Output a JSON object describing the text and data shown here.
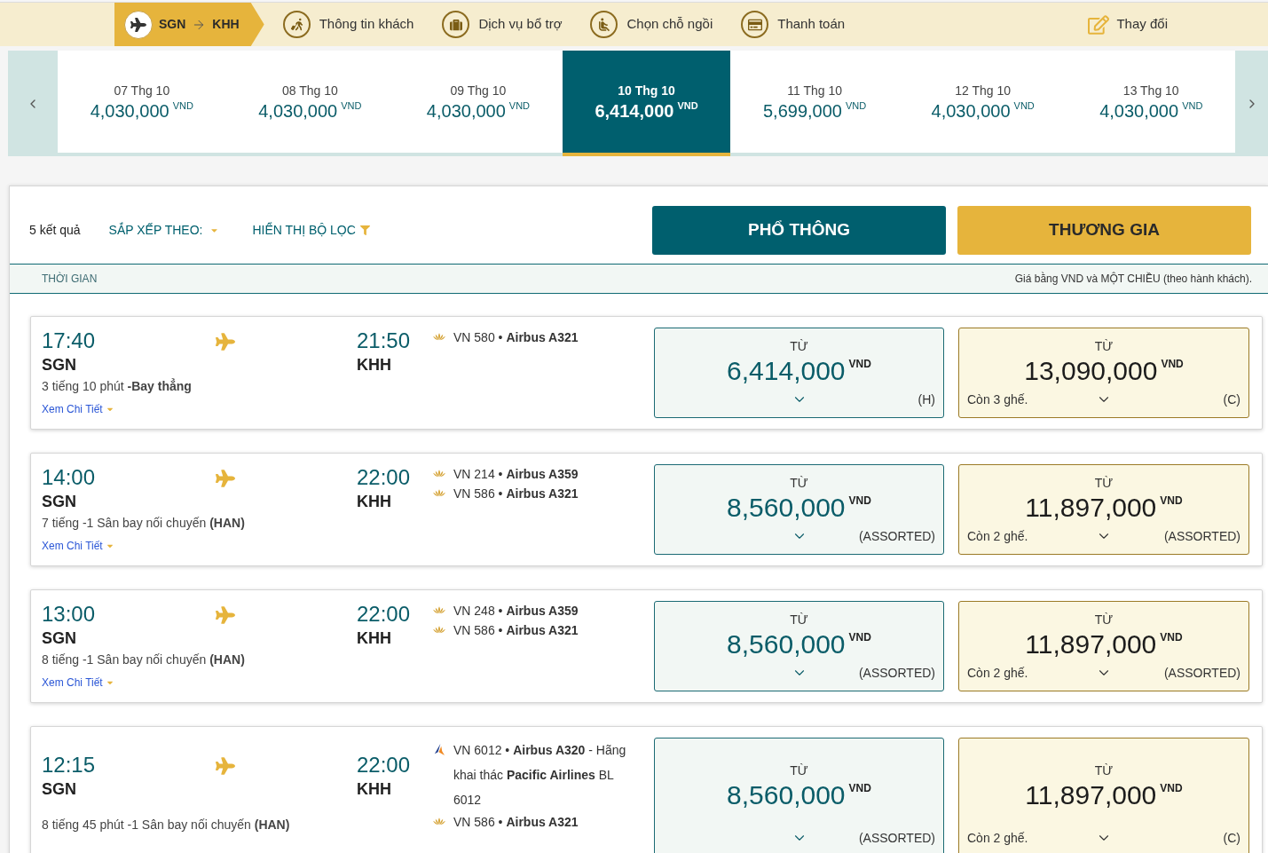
{
  "progress_steps": [
    {
      "kind": "route",
      "from": "SGN",
      "to": "KHH",
      "selected": true
    },
    {
      "kind": "passenger",
      "label": "Thông tin khách",
      "selected": false
    },
    {
      "kind": "extras",
      "label": "Dịch vụ bổ trợ",
      "selected": false
    },
    {
      "kind": "seat",
      "label": "Chọn chỗ ngồi",
      "selected": false
    },
    {
      "kind": "payment",
      "label": "Thanh toán",
      "selected": false
    }
  ],
  "change_link": {
    "label": "Thay đổi"
  },
  "date_tabs": [
    {
      "date": "07 Thg 10",
      "price": "4,030,000",
      "currency": "VND",
      "selected": false
    },
    {
      "date": "08 Thg 10",
      "price": "4,030,000",
      "currency": "VND",
      "selected": false
    },
    {
      "date": "09 Thg 10",
      "price": "4,030,000",
      "currency": "VND",
      "selected": false
    },
    {
      "date": "10 Thg 10",
      "price": "6,414,000",
      "currency": "VND",
      "selected": true
    },
    {
      "date": "11 Thg 10",
      "price": "5,699,000",
      "currency": "VND",
      "selected": false
    },
    {
      "date": "12 Thg 10",
      "price": "4,030,000",
      "currency": "VND",
      "selected": false
    },
    {
      "date": "13 Thg 10",
      "price": "4,030,000",
      "currency": "VND",
      "selected": false
    }
  ],
  "results_bar": {
    "count": "5 kết quả",
    "sort_label": "SẮP XẾP THEO:",
    "filter_label": "HIỂN THỊ BỘ LỌC"
  },
  "cabin_tabs": [
    {
      "kind": "economy",
      "label": "PHỔ THÔNG"
    },
    {
      "kind": "business",
      "label": "THƯƠNG GIA"
    }
  ],
  "list_header": {
    "column_1": "THỜI GIAN",
    "price_note": "Giá bằng VND và MỘT CHIỀU (theo hành khách)."
  },
  "flights": [
    {
      "depart_time": "17:40",
      "depart_airport": "SGN",
      "arrive_time": "21:50",
      "arrive_airport": "KHH",
      "duration": "3 tiếng 10 phút **-Bay thẳng**",
      "details_link": "Xem Chi Tiết",
      "segments": [
        {
          "kind": "direct",
          "text": "VN 580 • **Airbus A321**"
        }
      ],
      "fares": [
        {
          "kind": "economy",
          "from_label": "TỪ",
          "price": "6,414,000",
          "currency": "VND",
          "fare_class": "(H)"
        },
        {
          "kind": "business",
          "from_label": "TỪ",
          "price": "13,090,000",
          "currency": "VND",
          "seats_left": "Còn 3 ghế.",
          "fare_class": "(C)"
        }
      ]
    },
    {
      "depart_time": "14:00",
      "depart_airport": "SGN",
      "arrive_time": "22:00",
      "arrive_airport": "KHH",
      "duration": "7 tiếng -1 Sân bay nối chuyến **(HAN)**",
      "details_link": "Xem Chi Tiết",
      "segments": [
        {
          "kind": "direct",
          "text": "VN 214 • **Airbus A359**"
        },
        {
          "kind": "direct",
          "text": "VN 586 • **Airbus A321**"
        }
      ],
      "fares": [
        {
          "kind": "economy",
          "from_label": "TỪ",
          "price": "8,560,000",
          "currency": "VND",
          "fare_class": "(ASSORTED)"
        },
        {
          "kind": "business",
          "from_label": "TỪ",
          "price": "11,897,000",
          "currency": "VND",
          "seats_left": "Còn 2 ghế.",
          "fare_class": "(ASSORTED)"
        }
      ]
    },
    {
      "depart_time": "13:00",
      "depart_airport": "SGN",
      "arrive_time": "22:00",
      "arrive_airport": "KHH",
      "duration": "8 tiếng -1 Sân bay nối chuyến **(HAN)**",
      "details_link": "Xem Chi Tiết",
      "segments": [
        {
          "kind": "direct",
          "text": "VN 248 • **Airbus A359**"
        },
        {
          "kind": "direct",
          "text": "VN 586 • **Airbus A321**"
        }
      ],
      "fares": [
        {
          "kind": "economy",
          "from_label": "TỪ",
          "price": "8,560,000",
          "currency": "VND",
          "fare_class": "(ASSORTED)"
        },
        {
          "kind": "business",
          "from_label": "TỪ",
          "price": "11,897,000",
          "currency": "VND",
          "seats_left": "Còn 2 ghế.",
          "fare_class": "(ASSORTED)"
        }
      ]
    },
    {
      "depart_time": "12:15",
      "depart_airport": "SGN",
      "arrive_time": "22:00",
      "arrive_airport": "KHH",
      "duration": "8 tiếng 45 phút -1 Sân bay nối chuyến **(HAN)**",
      "segments": [
        {
          "kind": "partner",
          "text": "VN 6012 • **Airbus A320** - Hãng khai thác **Pacific Airlines** BL 6012"
        },
        {
          "kind": "direct",
          "text": "VN 586 • **Airbus A321**"
        }
      ],
      "fares": [
        {
          "kind": "economy",
          "from_label": "TỪ",
          "price": "8,560,000",
          "currency": "VND",
          "fare_class": "(ASSORTED)"
        },
        {
          "kind": "business",
          "from_label": "TỪ",
          "price": "11,897,000",
          "currency": "VND",
          "seats_left": "Còn 2 ghế.",
          "fare_class": "(C)"
        }
      ]
    }
  ]
}
